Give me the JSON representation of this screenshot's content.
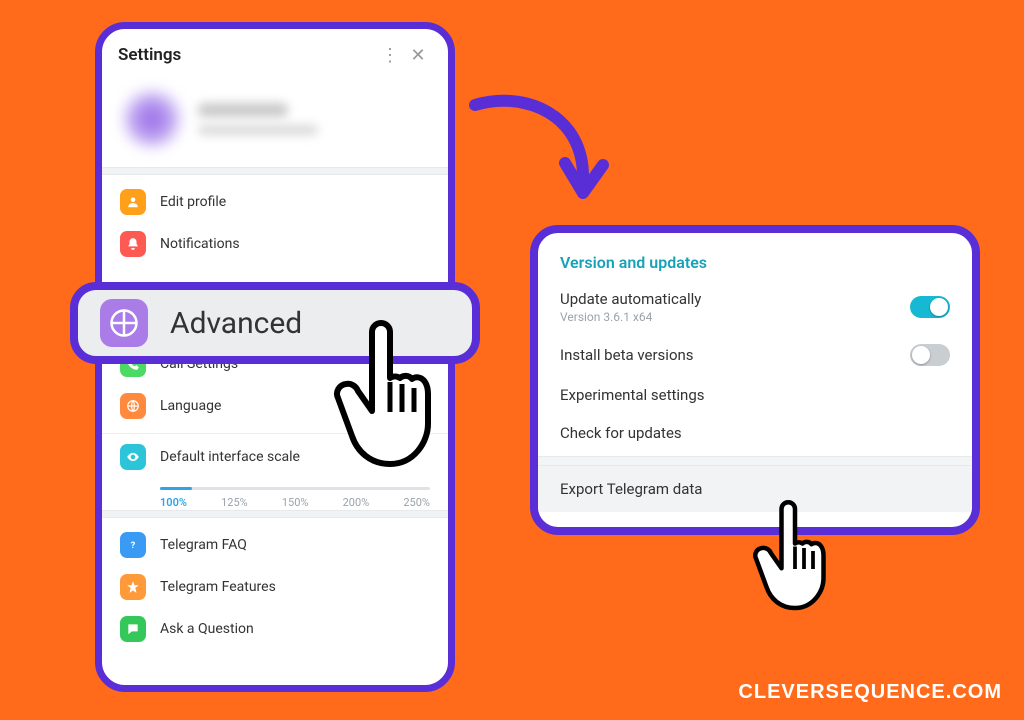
{
  "colors": {
    "accent": "#5a2ed6",
    "background": "#ff6b1a",
    "link": "#17a2b8"
  },
  "settings": {
    "title": "Settings",
    "menu": {
      "edit_profile": "Edit profile",
      "notifications": "Notifications",
      "call_settings": "Call Settings",
      "language": "Language"
    },
    "scale": {
      "label": "Default interface scale",
      "options": [
        "100%",
        "125%",
        "150%",
        "200%",
        "250%"
      ]
    },
    "help": {
      "faq": "Telegram FAQ",
      "features": "Telegram Features",
      "ask": "Ask a Question"
    }
  },
  "advanced": {
    "label": "Advanced"
  },
  "version_panel": {
    "heading": "Version and updates",
    "auto_update": {
      "label": "Update automatically",
      "version": "Version 3.6.1 x64",
      "on": true
    },
    "beta": {
      "label": "Install beta versions",
      "on": false
    },
    "experimental": "Experimental settings",
    "check": "Check for updates",
    "export": "Export Telegram data"
  },
  "watermark": "CLEVERSEQUENCE.COM"
}
